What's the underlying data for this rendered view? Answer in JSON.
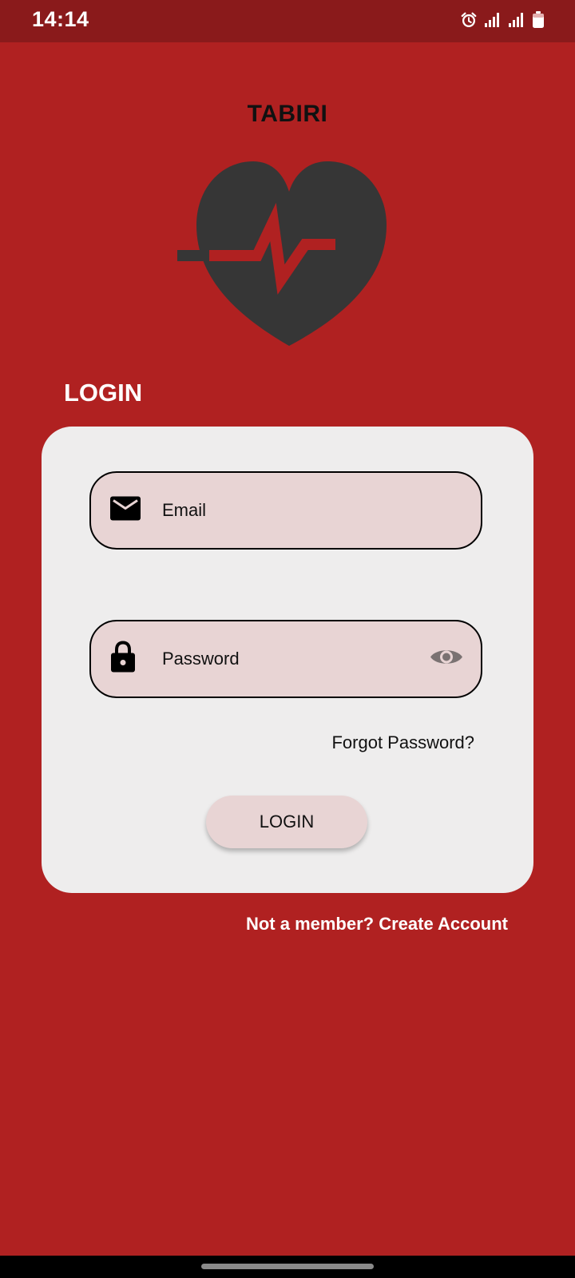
{
  "status_bar": {
    "time": "14:14",
    "icons": [
      "alarm-icon",
      "signal-icon",
      "signal-icon",
      "battery-icon"
    ]
  },
  "app": {
    "title": "TABIRI",
    "logo_icon": "heart-pulse-logo"
  },
  "login": {
    "heading": "LOGIN",
    "email_placeholder": "Email",
    "email_icon": "envelope-icon",
    "password_placeholder": "Password",
    "password_icon": "lock-icon",
    "password_toggle_icon": "eye-icon",
    "forgot_password": "Forgot Password?",
    "button_label": "LOGIN"
  },
  "signup": {
    "prompt": "Not a member? Create Account"
  },
  "colors": {
    "background": "#b02121",
    "status_bar": "#8a1a1b",
    "card": "#eeeded",
    "field": "#e8d4d4",
    "logo": "#363636"
  }
}
